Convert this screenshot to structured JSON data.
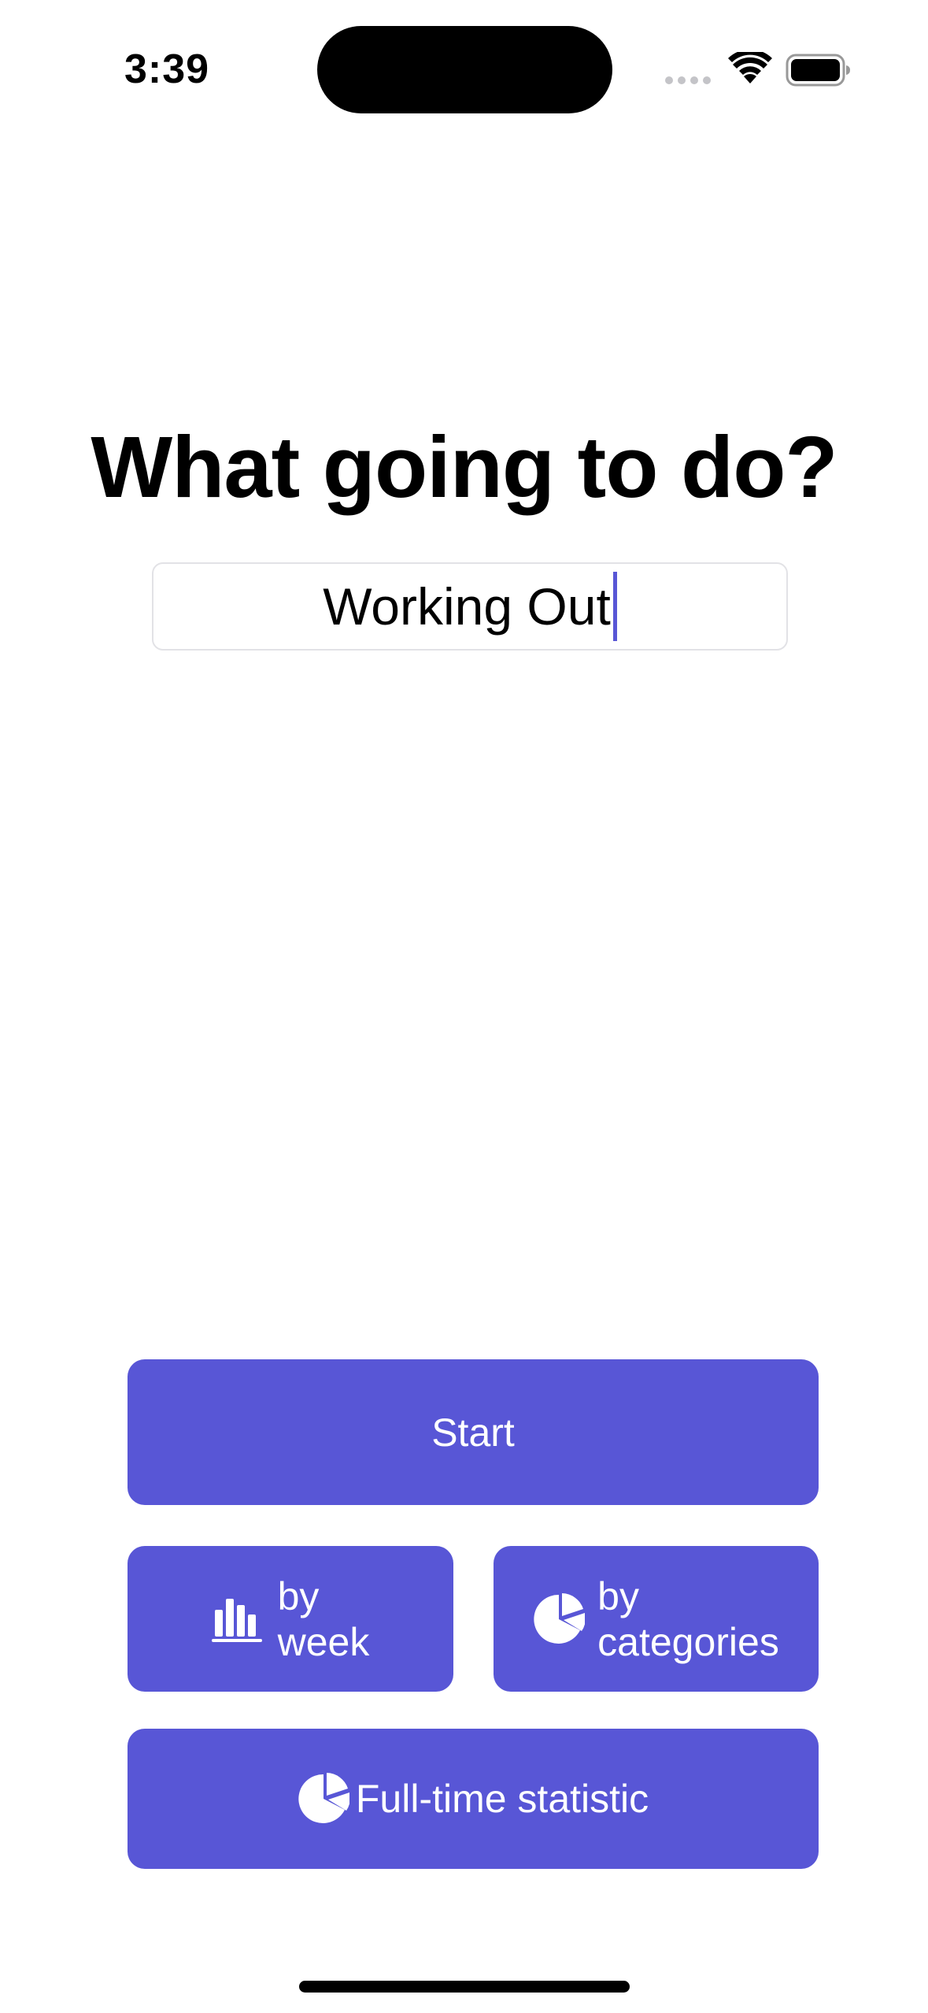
{
  "status_bar": {
    "time": "3:39"
  },
  "main": {
    "title": "What going to do?",
    "activity_input": {
      "value": "Working Out",
      "placeholder": ""
    }
  },
  "buttons": {
    "start": {
      "label": "Start"
    },
    "by_week": {
      "line1": "by",
      "line2": "week",
      "icon": "bar-chart-icon"
    },
    "by_categories": {
      "line1": "by",
      "line2": "categories",
      "icon": "pie-chart-icon"
    },
    "full_time": {
      "label": "Full-time statistic",
      "icon": "pie-chart-icon"
    }
  },
  "colors": {
    "accent": "#5856d6",
    "background": "#ffffff",
    "text": "#000000"
  }
}
